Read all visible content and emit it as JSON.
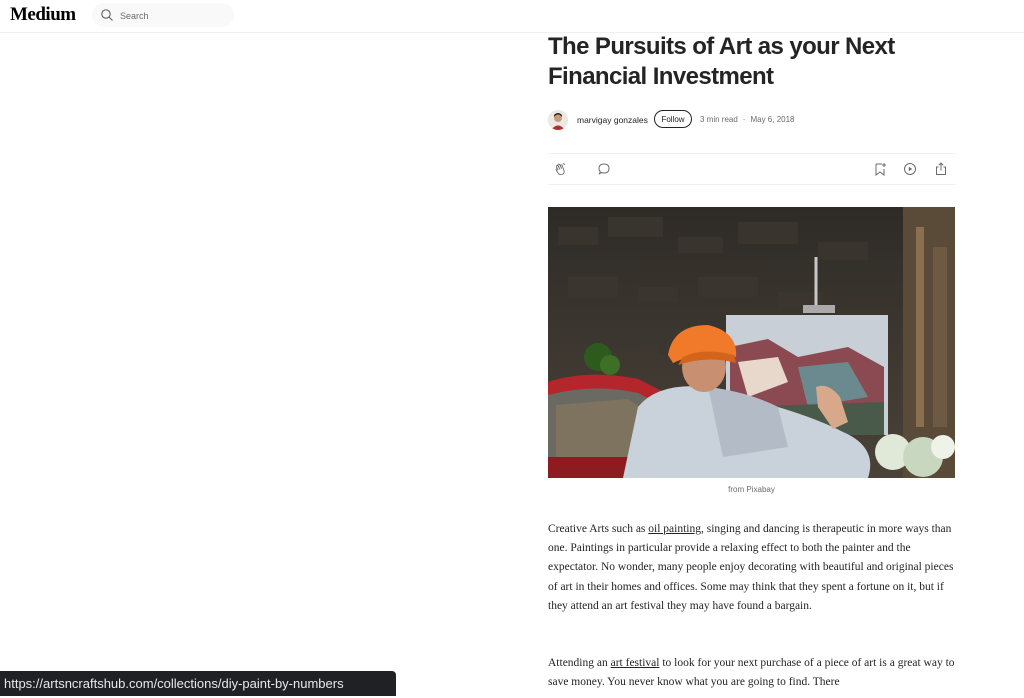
{
  "header": {
    "logo": "Medium",
    "search_placeholder": "Search"
  },
  "article": {
    "title": "The Pursuits of Art as your Next Financial Investment",
    "author": "marvigay gonzales",
    "follow_label": "Follow",
    "read_time": "3 min read",
    "separator": "·",
    "date": "May 6, 2018",
    "image_caption": "from Pixabay",
    "paragraph1": {
      "before_link": "Creative Arts such as ",
      "link_text": "oil painting",
      "after_link": ", singing and dancing is therapeutic in more ways than one. Paintings in particular provide a relaxing effect to both the painter and the expectator. No wonder, many people enjoy decorating with beautiful and original pieces of art in their homes and offices. Some may think that they spent a fortune on it, but if they attend an art festival they may have found a bargain."
    },
    "paragraph2": {
      "before_link": "Attending an ",
      "link_text": "art festival",
      "after_link": " to look for your next purchase of a piece of art is a great way to save money. You never know what you are going to find. There"
    }
  },
  "actions": {
    "icons": [
      "clap-icon",
      "comment-icon",
      "bookmark-add-icon",
      "play-icon",
      "share-icon"
    ]
  },
  "status_bar": {
    "url": "https://artsncraftshub.com/collections/diy-paint-by-numbers"
  }
}
